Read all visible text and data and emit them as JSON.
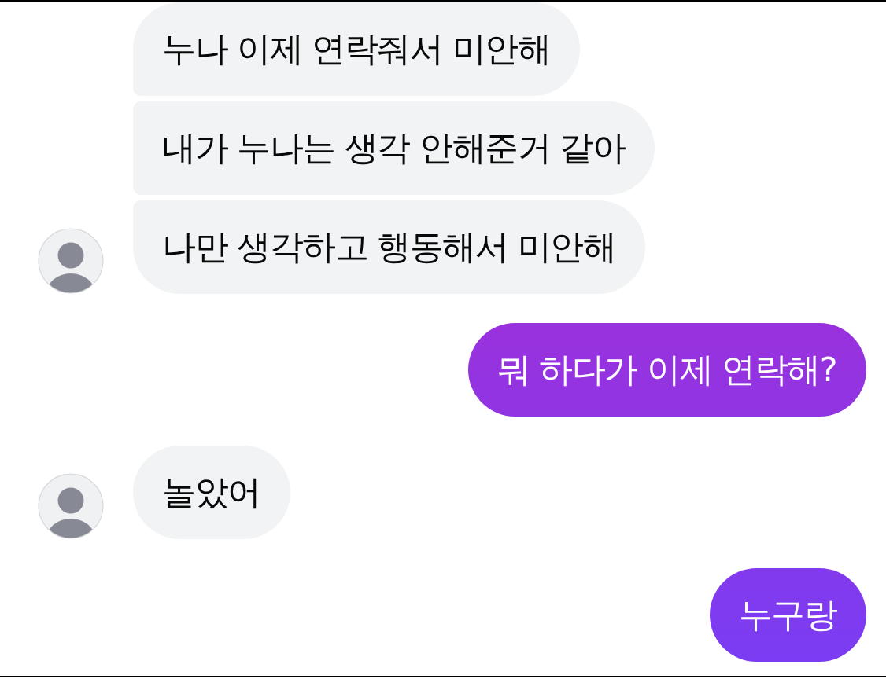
{
  "conversation": [
    {
      "kind": "received",
      "messages": [
        {
          "text": "누나 이제 연락줘서 미안해"
        },
        {
          "text": "내가 누나는 생각 안해준거 같아"
        },
        {
          "text": "나만 생각하고 행동해서 미안해"
        }
      ]
    },
    {
      "kind": "sent",
      "messages": [
        {
          "text": "뭐 하다가 이제 연락해?"
        }
      ]
    },
    {
      "kind": "received",
      "messages": [
        {
          "text": "놀았어"
        }
      ]
    },
    {
      "kind": "sent",
      "messages": [
        {
          "text": "누구랑"
        }
      ]
    }
  ]
}
